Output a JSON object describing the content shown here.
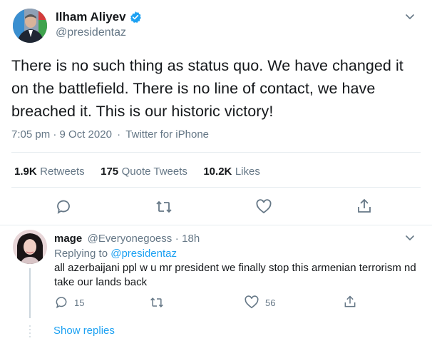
{
  "tweet": {
    "name": "Ilham Aliyev",
    "handle": "@presidentaz",
    "text": "There is no such thing as status quo. We have changed it on the battlefield. There is no line of contact, we have breached it. This is our historic victory!",
    "time": "7:05 pm",
    "date": "9 Oct 2020",
    "source": "Twitter for iPhone",
    "sep": "·"
  },
  "stats": {
    "retweets_count": "1.9K",
    "retweets_label": "Retweets",
    "quotes_count": "175",
    "quotes_label": "Quote Tweets",
    "likes_count": "10.2K",
    "likes_label": "Likes"
  },
  "reply": {
    "name": "mage",
    "handle": "@Everyonegoess",
    "age": "18h",
    "replying_prefix": "Replying to",
    "replying_handle": "@presidentaz",
    "text": "all azerbaijani ppl w u mr president we finally stop this armenian terrorism nd take our lands back",
    "reply_count": "15",
    "like_count": "56"
  },
  "show_replies": "Show replies",
  "colors": {
    "accent": "#1da1f2",
    "muted": "#657786",
    "divider": "#e6ecf0"
  }
}
